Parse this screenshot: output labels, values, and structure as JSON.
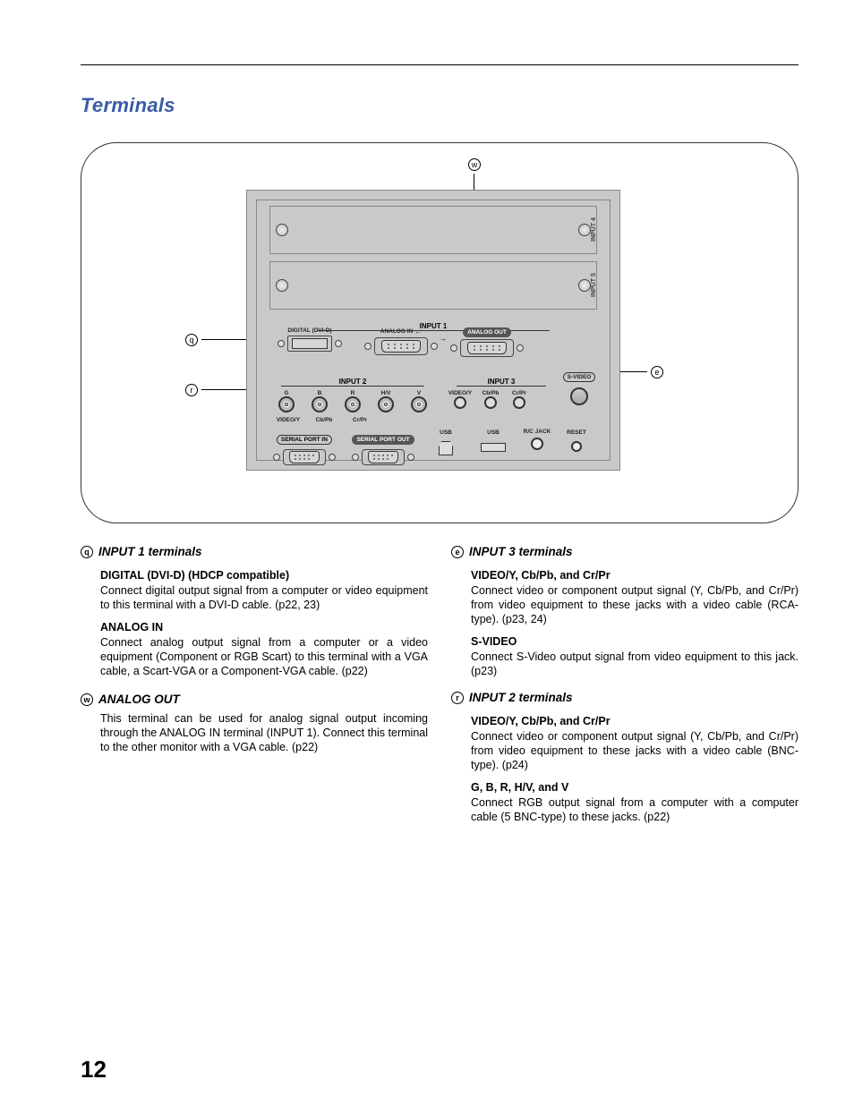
{
  "page_number": "12",
  "title": "Terminals",
  "diagram": {
    "callout_1": "q",
    "callout_2": "w",
    "callout_3": "e",
    "callout_4": "r",
    "slot4": "INPUT 4",
    "slot5": "INPUT 5",
    "input1": {
      "group": "INPUT 1",
      "digital": "DIGITAL (DVI-D)",
      "analog_in": "ANALOG IN",
      "analog_out": "ANALOG OUT"
    },
    "input2": {
      "group": "INPUT 2",
      "g": "G",
      "b": "B",
      "r": "R",
      "hv": "H/V",
      "v": "V",
      "sub_v": "VIDEO/Y",
      "sub_cb": "Cb/Pb",
      "sub_cr": "Cr/Pr"
    },
    "input3": {
      "group": "INPUT 3",
      "videoy": "VIDEO/Y",
      "cbpb": "Cb/Pb",
      "crpr": "Cr/Pr",
      "svideo": "S-VIDEO"
    },
    "bottom": {
      "serial_in": "SERIAL PORT IN",
      "serial_out": "SERIAL PORT OUT",
      "usb1": "USB",
      "usb2": "USB",
      "rcjack": "R/C JACK",
      "reset": "RESET"
    }
  },
  "sections": {
    "s1": {
      "num": "q",
      "title": "INPUT 1 terminals",
      "items": [
        {
          "label": "DIGITAL (DVI-D)  (HDCP compatible)",
          "body": "Connect digital output signal from a computer or video equipment  to this terminal with a DVI-D cable. (p22, 23)"
        },
        {
          "label": "ANALOG IN",
          "body": "Connect analog output signal from a computer or a video equipment (Component or RGB Scart) to this terminal with a VGA cable, a Scart-VGA or a Component-VGA cable. (p22)"
        }
      ]
    },
    "s2": {
      "num": "w",
      "title": "ANALOG OUT",
      "body": "This terminal can be used for analog signal output incoming through the ANALOG IN terminal (INPUT 1). Connect this terminal to the other monitor with a VGA cable. (p22)"
    },
    "s3": {
      "num": "e",
      "title": "INPUT 3 terminals",
      "items": [
        {
          "label": "VIDEO/Y, Cb/Pb, and Cr/Pr",
          "body": "Connect video or component output signal (Y, Cb/Pb, and Cr/Pr) from video equipment to these jacks with a video cable (RCA-type). (p23, 24)"
        },
        {
          "label": "S-VIDEO",
          "body": "Connect S-Video output signal from video equipment to this jack. (p23)"
        }
      ]
    },
    "s4": {
      "num": "r",
      "title": "INPUT 2 terminals",
      "items": [
        {
          "label": "VIDEO/Y, Cb/Pb, and Cr/Pr",
          "body": "Connect video or component output signal (Y, Cb/Pb, and Cr/Pr) from video equipment to these jacks with a video cable (BNC-type). (p24)"
        },
        {
          "label": "G, B, R, H/V, and V",
          "body": "Connect RGB output signal from a computer with a computer cable (5 BNC-type) to these jacks. (p22)"
        }
      ]
    }
  }
}
